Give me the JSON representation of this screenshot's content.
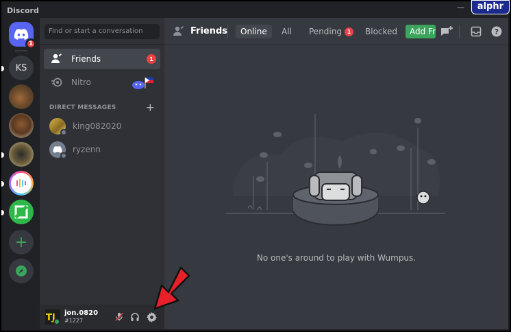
{
  "window": {
    "title": "Discord"
  },
  "watermark": {
    "text": "alphr"
  },
  "servers": [
    {
      "name": "home",
      "badge": "1"
    },
    {
      "name": "KS",
      "label": "KS"
    },
    {
      "name": "server-3"
    },
    {
      "name": "server-4"
    },
    {
      "name": "server-5"
    },
    {
      "name": "server-6"
    },
    {
      "name": "server-7"
    }
  ],
  "sidebar": {
    "search_placeholder": "Find or start a conversation",
    "friends_label": "Friends",
    "friends_badge": "1",
    "nitro_label": "Nitro",
    "dm_header": "DIRECT MESSAGES",
    "dm_add": "+",
    "dms": [
      {
        "name": "king082020"
      },
      {
        "name": "ryzenn"
      }
    ]
  },
  "user": {
    "name": "jon.0820",
    "tag": "#1227"
  },
  "topbar": {
    "title": "Friends",
    "tabs": [
      {
        "label": "Online"
      },
      {
        "label": "All"
      },
      {
        "label": "Pending",
        "badge": "1"
      },
      {
        "label": "Blocked"
      }
    ],
    "add_friend": "Add Friend"
  },
  "main": {
    "empty_text": "No one's around to play with Wumpus."
  },
  "colors": {
    "accent": "#5865f2",
    "green": "#3ba55d",
    "red": "#ed4245",
    "arrow": "#e8202a"
  }
}
